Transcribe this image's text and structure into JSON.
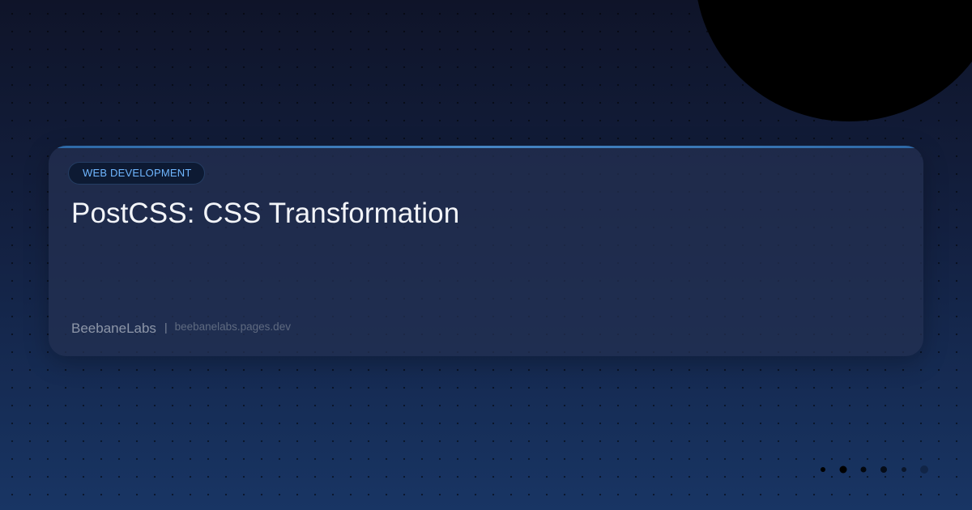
{
  "card": {
    "category": "WEB DEVELOPMENT",
    "title": "PostCSS: CSS Transformation",
    "brand": "BeebaneLabs",
    "separator": "|",
    "url": "beebanelabs.pages.dev"
  },
  "pager": {
    "dot_count": 6,
    "active_index": 1
  },
  "colors": {
    "background_top": "#0f1429",
    "background_bottom": "#183564",
    "card_background": "#243052",
    "accent_line": "#4a8fd0",
    "category_text": "#6fb6ff",
    "title_text": "#f2f4f8",
    "brand_text": "#8d96a8",
    "url_text": "#5f6a80",
    "blob": "#000000"
  }
}
